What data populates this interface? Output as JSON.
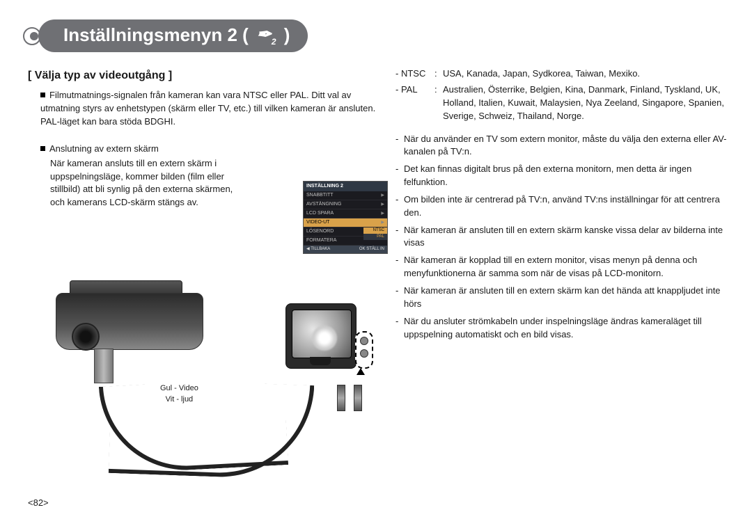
{
  "title": {
    "text_before": "Inställningsmenyn 2 (",
    "icon_label": "tool-2-icon",
    "text_after": ")"
  },
  "left": {
    "section_heading": "[ Välja typ av videoutgång ]",
    "intro_label": "Filmutmatnings-signalen från kameran kan vara NTSC eller PAL. Ditt val av utmatning styrs av enhetstypen (skärm eller TV, etc.) till vilken kameran är ansluten. PAL-läget kan bara stöda BDGHI.",
    "sub_label": "Anslutning av extern skärm",
    "sub_body": "När kameran ansluts till en extern skärm i uppspelningsläge, kommer bilden (film eller stillbild) att bli synlig på den externa skärmen, och kamerans LCD-skärm stängs av.",
    "caption_line1": "Gul - Video",
    "caption_line2": "Vit - ljud"
  },
  "lcd_menu": {
    "header": "INSTÄLLNING 2",
    "items": [
      "SNABBTITT",
      "AVSTÄNGNING",
      "LCD SPARA",
      "VIDEO-UT",
      "LÖSENORD",
      "FORMATERA"
    ],
    "submenu_ntsc": "NTSC",
    "submenu_pal": "PAL",
    "footer_back": "TILLBAKA",
    "footer_ok": "OK",
    "footer_set": "STÄLL IN"
  },
  "right": {
    "ntsc_key": "- NTSC",
    "ntsc_val": "USA, Kanada, Japan, Sydkorea, Taiwan, Mexiko.",
    "pal_key": "- PAL",
    "pal_val": "Australien, Österrike, Belgien, Kina, Danmark, Finland, Tyskland, UK, Holland, Italien, Kuwait, Malaysien, Nya Zeeland, Singapore, Spanien, Sverige, Schweiz, Thailand, Norge.",
    "bullets": [
      "När du använder en TV som extern monitor, måste du välja den externa eller AV-kanalen på TV:n.",
      "Det kan finnas digitalt brus på den externa monitorn, men detta är ingen felfunktion.",
      "Om bilden inte är centrerad på TV:n, använd TV:ns inställningar för att centrera den.",
      "När kameran är ansluten till en extern skärm kanske vissa delar av bilderna inte visas",
      "När kameran är kopplad till en extern monitor, visas menyn på denna och menyfunktionerna är samma som när de visas på LCD-monitorn.",
      "När kameran är ansluten till en extern skärm kan det hända att knappljudet inte hörs",
      "När du ansluter strömkabeln under inspelningsläge ändras kameraläget till uppspelning automatiskt och en bild visas."
    ]
  },
  "page_number": "<82>"
}
